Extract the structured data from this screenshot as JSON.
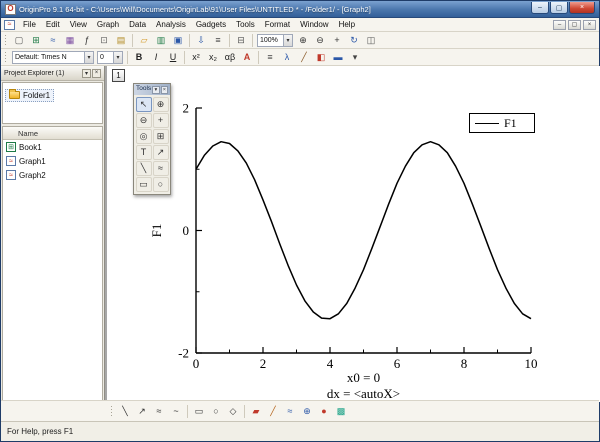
{
  "window": {
    "icon_glyph": "O",
    "title": "OriginPro 9.1 64-bit - C:\\Users\\Will\\Documents\\OriginLab\\91\\User Files\\UNTITLED * - /Folder1/ - [Graph2]",
    "controls": [
      {
        "name": "minimize-button",
        "glyph": "–",
        "cls": "min"
      },
      {
        "name": "maximize-button",
        "glyph": "▢",
        "cls": "max"
      },
      {
        "name": "close-button",
        "glyph": "×",
        "cls": "close"
      }
    ]
  },
  "menu_bar": {
    "child_icon_glyph": "≈",
    "items": [
      "File",
      "Edit",
      "View",
      "Graph",
      "Data",
      "Analysis",
      "Gadgets",
      "Tools",
      "Format",
      "Window",
      "Help"
    ],
    "child_controls": [
      {
        "name": "child-minimize-button",
        "glyph": "–"
      },
      {
        "name": "child-restore-button",
        "glyph": "▢"
      },
      {
        "name": "child-close-button",
        "glyph": "×"
      }
    ]
  },
  "standard_toolbar": {
    "items": [
      {
        "t": "grip"
      },
      {
        "t": "b",
        "n": "new-project-button",
        "g": "▢",
        "c": "#555"
      },
      {
        "t": "b",
        "n": "new-workbook-button",
        "g": "⊞",
        "c": "#1d7a46"
      },
      {
        "t": "b",
        "n": "new-graph-button",
        "g": "≈",
        "c": "#2b57a8"
      },
      {
        "t": "b",
        "n": "new-matrix-button",
        "g": "▦",
        "c": "#7a4aa0"
      },
      {
        "t": "b",
        "n": "new-function-button",
        "g": "ƒ",
        "c": "#333333"
      },
      {
        "t": "b",
        "n": "new-layout-button",
        "g": "⊡",
        "c": "#666666"
      },
      {
        "t": "b",
        "n": "new-notes-button",
        "g": "▤",
        "c": "#b08820"
      },
      {
        "t": "s"
      },
      {
        "t": "b",
        "n": "open-button",
        "g": "▱",
        "c": "#d49a2a"
      },
      {
        "t": "b",
        "n": "open-excel-button",
        "g": "▥",
        "c": "#1d7a46"
      },
      {
        "t": "b",
        "n": "save-project-button",
        "g": "▣",
        "c": "#2b57a8"
      },
      {
        "t": "s"
      },
      {
        "t": "b",
        "n": "import-wizard-button",
        "g": "⇩",
        "c": "#2b57a8"
      },
      {
        "t": "b",
        "n": "import-ascii-button",
        "g": "≡",
        "c": "#444444"
      },
      {
        "t": "s"
      },
      {
        "t": "b",
        "n": "print-button",
        "g": "⊟",
        "c": "#555555"
      },
      {
        "t": "s"
      },
      {
        "t": "combo",
        "n": "zoom-combo",
        "v": "100%",
        "w": 36
      },
      {
        "t": "b",
        "n": "zoom-in-button",
        "g": "⊕",
        "c": "#333333"
      },
      {
        "t": "b",
        "n": "zoom-out-button",
        "g": "⊖",
        "c": "#333333"
      },
      {
        "t": "b",
        "n": "rescale-button",
        "g": "+",
        "c": "#333333"
      },
      {
        "t": "b",
        "n": "refresh-button",
        "g": "↻",
        "c": "#2b57a8"
      },
      {
        "t": "b",
        "n": "duplicate-window-button",
        "g": "◫",
        "c": "#555555"
      }
    ]
  },
  "format_toolbar": {
    "items": [
      {
        "t": "grip"
      },
      {
        "t": "combo",
        "n": "style-combo",
        "v": "Default: Times N",
        "w": 82
      },
      {
        "t": "combo",
        "n": "font-size-combo",
        "v": "0",
        "w": 26
      },
      {
        "t": "s"
      },
      {
        "t": "b",
        "n": "bold-button",
        "g": "B",
        "c": "#222222",
        "fw": "bold"
      },
      {
        "t": "b",
        "n": "italic-button",
        "g": "I",
        "c": "#222222",
        "fs": "italic"
      },
      {
        "t": "b",
        "n": "underline-button",
        "g": "U",
        "c": "#222222",
        "td": "underline"
      },
      {
        "t": "s"
      },
      {
        "t": "b",
        "n": "superscript-button",
        "g": "x²",
        "c": "#222222"
      },
      {
        "t": "b",
        "n": "subscript-button",
        "g": "x₂",
        "c": "#222222"
      },
      {
        "t": "b",
        "n": "greek-button",
        "g": "αβ",
        "c": "#222222"
      },
      {
        "t": "b",
        "n": "font-color-button",
        "g": "A",
        "c": "#c0392b",
        "fw": "bold"
      },
      {
        "t": "s"
      },
      {
        "t": "b",
        "n": "align-left-button",
        "g": "≡",
        "c": "#444444"
      },
      {
        "t": "b",
        "n": "lambda-button",
        "g": "λ",
        "c": "#2b57a8"
      },
      {
        "t": "b",
        "n": "draw-button",
        "g": "╱",
        "c": "#8a5a2a"
      },
      {
        "t": "b",
        "n": "fill-color-button",
        "g": "◧",
        "c": "#c0392b"
      },
      {
        "t": "b",
        "n": "line-color-button",
        "g": "▬",
        "c": "#2b57a8"
      },
      {
        "t": "b",
        "n": "more-options-button",
        "g": "▾",
        "c": "#444444"
      }
    ]
  },
  "bottom_toolbar": {
    "items": [
      {
        "t": "grip"
      },
      {
        "t": "b",
        "n": "line-tool-button",
        "g": "╲",
        "c": "#333333"
      },
      {
        "t": "b",
        "n": "arrow-tool-button",
        "g": "↗",
        "c": "#333333"
      },
      {
        "t": "b",
        "n": "curve-tool-button",
        "g": "≈",
        "c": "#333333"
      },
      {
        "t": "b",
        "n": "freehand-tool-button",
        "g": "~",
        "c": "#333333"
      },
      {
        "t": "s"
      },
      {
        "t": "b",
        "n": "rectangle-tool-button",
        "g": "▭",
        "c": "#333333"
      },
      {
        "t": "b",
        "n": "ellipse-tool-button",
        "g": "○",
        "c": "#333333"
      },
      {
        "t": "b",
        "n": "polygon-tool-button",
        "g": "◇",
        "c": "#333333"
      },
      {
        "t": "s"
      },
      {
        "t": "b",
        "n": "marker-tool-button",
        "g": "▰",
        "c": "#c0392b"
      },
      {
        "t": "b",
        "n": "pencil-tool-button",
        "g": "╱",
        "c": "#b5651d"
      },
      {
        "t": "b",
        "n": "spline-tool-button",
        "g": "≈",
        "c": "#2b57a8"
      },
      {
        "t": "b",
        "n": "compass-tool-button",
        "g": "⊕",
        "c": "#2b57a8"
      },
      {
        "t": "b",
        "n": "color-ball-button",
        "g": "●",
        "c": "#c0392b"
      },
      {
        "t": "b",
        "n": "color-grid-button",
        "g": "▩",
        "c": "#16a085"
      }
    ]
  },
  "project_explorer": {
    "title": "Project Explorer (1)",
    "menu_glyph": "▾",
    "close_glyph": "×",
    "folder_label": "Folder1",
    "list_header": "Name",
    "items": [
      {
        "label": "Book1",
        "icon": "workbook",
        "glyph": "⊞"
      },
      {
        "label": "Graph1",
        "icon": "graph",
        "glyph": "≈"
      },
      {
        "label": "Graph2",
        "icon": "graph",
        "glyph": "≈"
      }
    ]
  },
  "graph_window": {
    "layer_button": "1"
  },
  "tools_palette": {
    "title": "Tools",
    "menu_glyph": "▾",
    "close_glyph": "×",
    "buttons": [
      {
        "n": "pointer-tool",
        "g": "↖",
        "pressed": true
      },
      {
        "n": "zoom-in-tool",
        "g": "⊕"
      },
      {
        "n": "zoom-out-tool",
        "g": "⊖"
      },
      {
        "n": "screen-reader-tool",
        "g": "+"
      },
      {
        "n": "data-reader-tool",
        "g": "◎"
      },
      {
        "n": "selector-tool",
        "g": "⊞"
      },
      {
        "n": "text-tool",
        "g": "T"
      },
      {
        "n": "arrow-tool",
        "g": "↗"
      },
      {
        "n": "line-tool",
        "g": "╲"
      },
      {
        "n": "curve-tool",
        "g": "≈"
      },
      {
        "n": "rectangle-tool",
        "g": "▭"
      },
      {
        "n": "ellipse-tool",
        "g": "○"
      }
    ]
  },
  "chart_data": {
    "type": "line",
    "title": "",
    "ylabel": "F1",
    "legend": "F1",
    "x_annotations": [
      "x0 = 0",
      "dx = <autoX>"
    ],
    "xlim": [
      0,
      10
    ],
    "ylim": [
      -2,
      2
    ],
    "xticks": [
      0,
      2,
      4,
      6,
      8,
      10
    ],
    "xminorticks": [
      1,
      3,
      5,
      7,
      9
    ],
    "yticks": [
      2,
      0,
      -2
    ],
    "yminorticks": [
      1,
      -1
    ],
    "grid": false,
    "legend_position": "top-right",
    "series": [
      {
        "name": "F1",
        "color": "#000000",
        "x": [
          0,
          0.25,
          0.5,
          0.75,
          1,
          1.25,
          1.5,
          1.75,
          2,
          2.25,
          2.5,
          2.75,
          3,
          3.25,
          3.5,
          3.75,
          4,
          4.25,
          4.5,
          4.75,
          5,
          5.25,
          5.5,
          5.75,
          6,
          6.25,
          6.5,
          6.75,
          7,
          7.25,
          7.5,
          7.75,
          8,
          8.25,
          8.5,
          8.75,
          9,
          9.25,
          9.5,
          9.75,
          10
        ],
        "y": [
          1.0,
          1.23,
          1.38,
          1.45,
          1.42,
          1.3,
          1.1,
          0.83,
          0.5,
          0.15,
          -0.22,
          -0.57,
          -0.89,
          -1.15,
          -1.33,
          -1.43,
          -1.44,
          -1.36,
          -1.19,
          -0.94,
          -0.64,
          -0.29,
          0.07,
          0.43,
          0.77,
          1.05,
          1.27,
          1.4,
          1.45,
          1.4,
          1.27,
          1.05,
          0.77,
          0.43,
          0.07,
          -0.29,
          -0.64,
          -0.94,
          -1.19,
          -1.36,
          -1.44
        ]
      }
    ]
  },
  "status_bar": {
    "text": "For Help, press F1"
  }
}
